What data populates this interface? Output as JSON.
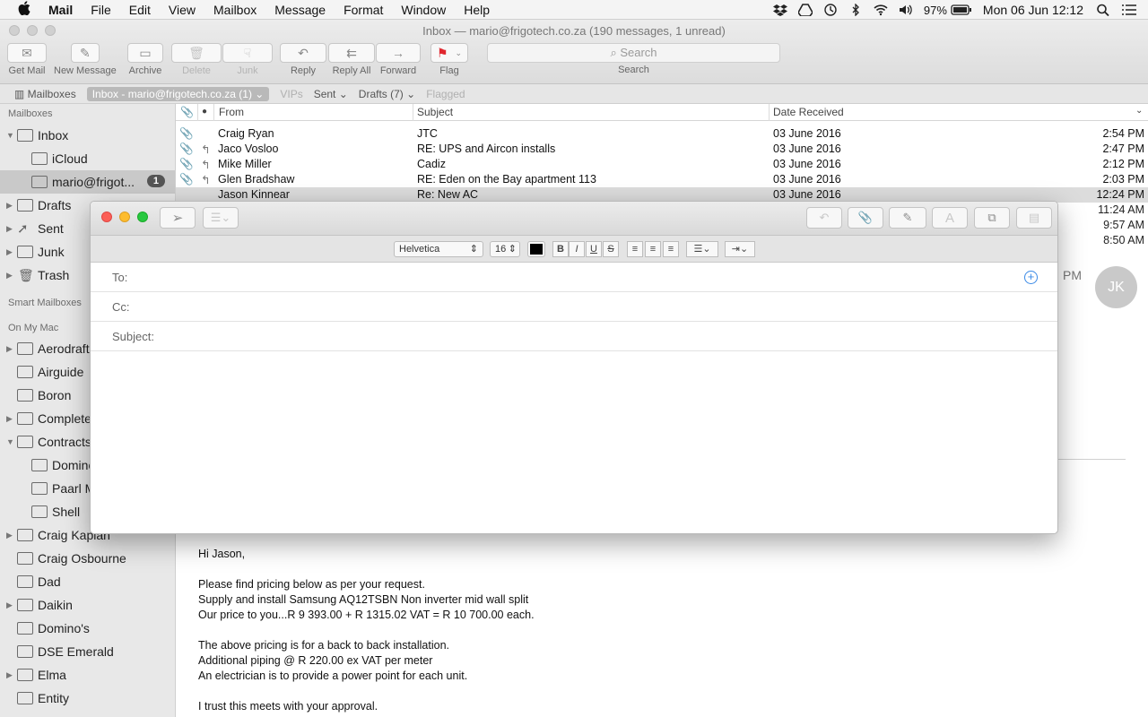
{
  "menubar": {
    "app": "Mail",
    "menus": [
      "File",
      "Edit",
      "View",
      "Mailbox",
      "Message",
      "Format",
      "Window",
      "Help"
    ],
    "battery": "97%",
    "datetime": "Mon 06 Jun  12:12"
  },
  "window": {
    "title": "Inbox — mario@frigotech.co.za (190 messages, 1 unread)"
  },
  "toolbar": {
    "get_mail": "Get Mail",
    "new_message": "New Message",
    "archive": "Archive",
    "delete": "Delete",
    "junk": "Junk",
    "reply": "Reply",
    "reply_all": "Reply All",
    "forward": "Forward",
    "flag": "Flag",
    "search_placeholder": "Search",
    "search_label": "Search"
  },
  "favbar": {
    "mailboxes": "Mailboxes",
    "inbox": "Inbox - mario@frigotech.co.za (1)",
    "vips": "VIPs",
    "sent": "Sent",
    "drafts": "Drafts (7)",
    "flagged": "Flagged"
  },
  "sidebar": {
    "header_mailboxes": "Mailboxes",
    "header_smart": "Smart Mailboxes",
    "header_onmymac": "On My Mac",
    "inbox": "Inbox",
    "icloud": "iCloud",
    "account": "mario@frigot...",
    "account_badge": "1",
    "drafts": "Drafts",
    "sent": "Sent",
    "junk": "Junk",
    "trash": "Trash",
    "folders": [
      "Aerodraft",
      "Airguide",
      "Boron",
      "Complete",
      "Contracts",
      "Domino",
      "Paarl M",
      "Shell",
      "Craig Kaplan",
      "Craig Osbourne",
      "Dad",
      "Daikin",
      "Domino's",
      "DSE Emerald",
      "Elma",
      "Entity"
    ]
  },
  "list": {
    "col_from": "From",
    "col_subject": "Subject",
    "col_date": "Date Received",
    "rows": [
      {
        "from": "Craig Ryan",
        "subject": "JTC",
        "date": "03 June 2016",
        "time": "2:54 PM"
      },
      {
        "from": "Jaco Vosloo",
        "subject": "RE: UPS and Aircon installs",
        "date": "03 June 2016",
        "time": "2:47 PM"
      },
      {
        "from": "Mike Miller",
        "subject": "Cadiz",
        "date": "03 June 2016",
        "time": "2:12 PM"
      },
      {
        "from": "Glen Bradshaw",
        "subject": "RE: Eden on the Bay apartment 113",
        "date": "03 June 2016",
        "time": "2:03 PM"
      },
      {
        "from": "Jason Kinnear",
        "subject": "Re: New AC",
        "date": "03 June 2016",
        "time": "12:24 PM"
      }
    ],
    "hidden_times": [
      "11:24 AM",
      "9:57 AM",
      "8:50 AM"
    ]
  },
  "preview": {
    "time_partial": "PM",
    "avatar_initials": "JK",
    "body": [
      "Hi Jason,",
      "Please find pricing below as per your request.",
      "Supply and install Samsung AQ12TSBN Non inverter mid wall split",
      "Our price to you...R 9 393.00 + R 1315.02 VAT = R 10 700.00 each.",
      "The above pricing is for a back to back installation.",
      "Additional piping @ R 220.00 ex VAT per meter",
      "An electrician is to provide a power point for each unit.",
      "I trust this meets with your approval."
    ]
  },
  "compose": {
    "font": "Helvetica",
    "size": "16",
    "to_label": "To:",
    "cc_label": "Cc:",
    "subject_label": "Subject:",
    "to_value": "",
    "cc_value": "",
    "subject_value": ""
  }
}
